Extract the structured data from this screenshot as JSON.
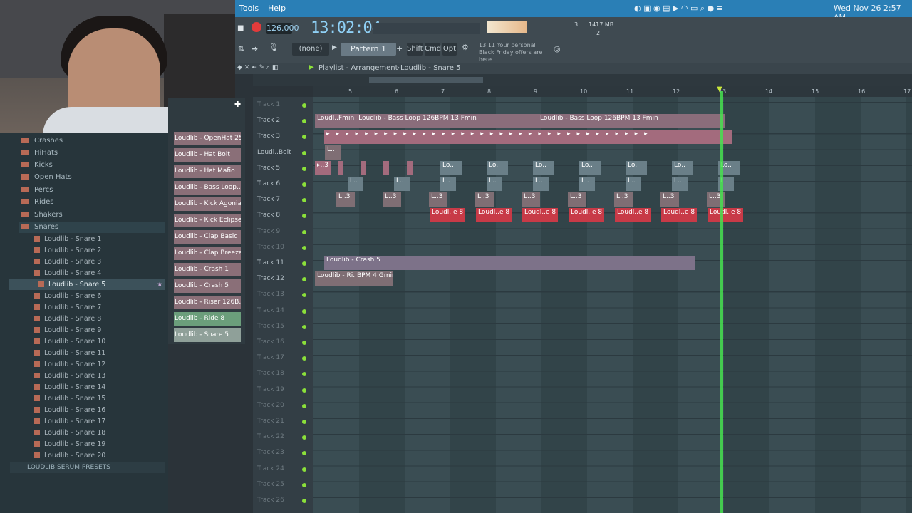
{
  "menubar": {
    "tools": "Tools",
    "help": "Help",
    "datetime": "Wed Nov 26  2:57 AM"
  },
  "toolbar": {
    "tempo": "126.000",
    "time": "13:02:04",
    "none_label": "(none)",
    "pattern": "Pattern 1",
    "shift": "Shift",
    "cmd": "Cmd",
    "opt": "Opt",
    "hint": "13:11  Your personal Black Friday offers are here",
    "memory": "1417 MB",
    "cpu": "3",
    "voices": "2"
  },
  "playlist": {
    "title": "Playlist - Arrangement",
    "pattern": "Loudlib - Snare 5",
    "ticks": [
      "5",
      "6",
      "7",
      "8",
      "9",
      "10",
      "11",
      "12",
      "13",
      "14",
      "15",
      "16",
      "17"
    ],
    "tracks": [
      "Track 1",
      "Track 2",
      "Track 3",
      "Loudl..Bolt",
      "Track 5",
      "Track 6",
      "Track 7",
      "Track 8",
      "Track 9",
      "Track 10",
      "Track 11",
      "Track 12",
      "Track 13",
      "Track 14",
      "Track 15",
      "Track 16",
      "Track 17",
      "Track 18",
      "Track 19",
      "Track 20",
      "Track 21",
      "Track 22",
      "Track 23",
      "Track 24",
      "Track 25",
      "Track 26"
    ]
  },
  "clips": {
    "bass1": "Loudl..Fmin",
    "bass2": "Loudlib - Bass Loop 126BPM 13 Fmin",
    "bass3": "Loudlib - Bass Loop 126BPM 13 Fmin",
    "lo": "Lo..",
    "l3": "L..3",
    "l": "L..",
    "red": "Loudl..e 8",
    "crash": "Loudlib - Crash 5",
    "riser": "Loudlib - Ri..BPM 4 Gminor"
  },
  "browser": {
    "folders": [
      "Crashes",
      "HiHats",
      "Kicks",
      "Open Hats",
      "Percs",
      "Rides",
      "Shakers",
      "Snares"
    ],
    "snares": [
      "Loudlib - Snare 1",
      "Loudlib - Snare 2",
      "Loudlib - Snare 3",
      "Loudlib - Snare 4",
      "Loudlib - Snare 5",
      "Loudlib - Snare 6",
      "Loudlib - Snare 7",
      "Loudlib - Snare 8",
      "Loudlib - Snare 9",
      "Loudlib - Snare 10",
      "Loudlib - Snare 11",
      "Loudlib - Snare 12",
      "Loudlib - Snare 13",
      "Loudlib - Snare 14",
      "Loudlib - Snare 15",
      "Loudlib - Snare 16",
      "Loudlib - Snare 17",
      "Loudlib - Snare 18",
      "Loudlib - Snare 19",
      "Loudlib - Snare 20"
    ],
    "bottom": "LOUDLIB SERUM PRESETS"
  },
  "channels": [
    "Loudlib - OpenHat 25",
    "Loudlib - Hat Bolt",
    "Loudlib - Hat Mafio",
    "Loudlib - Bass Loop..",
    "Loudlib - Kick Agonia",
    "Loudlib - Kick Eclipse",
    "Loudlib - Clap Basic",
    "Loudlib - Clap Breeze",
    "Loudlib - Crash 1",
    "Loudlib - Crash 5",
    "Loudlib - Riser 126B..",
    "Loudlib - Ride 8",
    "Loudlib - Snare 5"
  ]
}
